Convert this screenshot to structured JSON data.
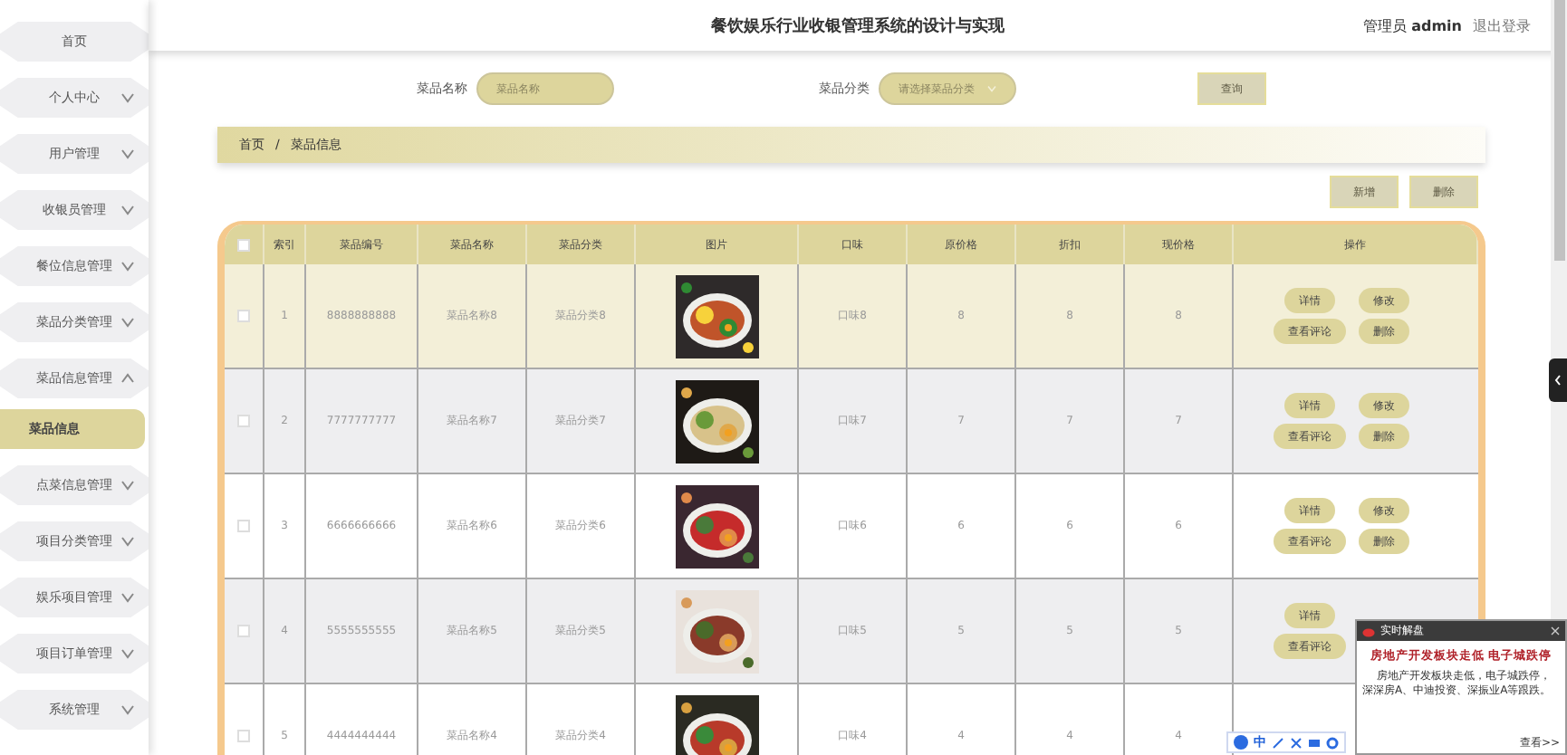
{
  "sidebar": {
    "items": [
      {
        "label": "首页"
      },
      {
        "label": "个人中心",
        "expanded": false
      },
      {
        "label": "用户管理",
        "expanded": false
      },
      {
        "label": "收银员管理",
        "expanded": false
      },
      {
        "label": "餐位信息管理",
        "expanded": false
      },
      {
        "label": "菜品分类管理",
        "expanded": false
      },
      {
        "label": "菜品信息管理",
        "expanded": true,
        "children": [
          {
            "label": "菜品信息",
            "selected": true
          }
        ]
      },
      {
        "label": "点菜信息管理",
        "expanded": false
      },
      {
        "label": "项目分类管理",
        "expanded": false
      },
      {
        "label": "娱乐项目管理",
        "expanded": false
      },
      {
        "label": "项目订单管理",
        "expanded": false
      },
      {
        "label": "系统管理",
        "expanded": false
      }
    ]
  },
  "header": {
    "title": "餐饮娱乐行业收银管理系统的设计与实现",
    "role": "管理员",
    "user": "admin",
    "logout": "退出登录"
  },
  "search": {
    "fields": [
      {
        "label": "菜品名称",
        "placeholder": "菜品名称",
        "kind": "text"
      },
      {
        "label": "菜品分类",
        "placeholder": "请选择菜品分类",
        "kind": "select"
      }
    ],
    "button": "查询"
  },
  "breadcrumb": {
    "items": [
      "首页",
      "菜品信息"
    ],
    "separator": "/"
  },
  "actions": [
    "新增",
    "删除"
  ],
  "table": {
    "header_checked": false,
    "columns": [
      "索引",
      "菜品编号",
      "菜品名称",
      "菜品分类",
      "图片",
      "口味",
      "原价格",
      "折扣",
      "现价格",
      "操作"
    ],
    "rows": [
      {
        "checked": false,
        "selected": true,
        "index": "1",
        "code": "8888888888",
        "name": "菜品名称8",
        "category": "菜品分类8",
        "taste": "口味8",
        "price": "8",
        "discount": "8",
        "current": "8",
        "buttons": [
          [
            "详情",
            "修改"
          ],
          [
            "查看评论",
            "删除"
          ]
        ],
        "picture": {
          "kind": "picture"
        }
      },
      {
        "checked": false,
        "selected": false,
        "index": "2",
        "code": "7777777777",
        "name": "菜品名称7",
        "category": "菜品分类7",
        "taste": "口味7",
        "price": "7",
        "discount": "7",
        "current": "7",
        "buttons": [
          [
            "详情",
            "修改"
          ],
          [
            "查看评论",
            "删除"
          ]
        ],
        "picture": {
          "kind": "picture"
        }
      },
      {
        "checked": false,
        "selected": false,
        "index": "3",
        "code": "6666666666",
        "name": "菜品名称6",
        "category": "菜品分类6",
        "taste": "口味6",
        "price": "6",
        "discount": "6",
        "current": "6",
        "buttons": [
          [
            "详情",
            "修改"
          ],
          [
            "查看评论",
            "删除"
          ]
        ],
        "picture": {
          "kind": "picture"
        }
      },
      {
        "checked": false,
        "selected": false,
        "index": "4",
        "code": "5555555555",
        "name": "菜品名称5",
        "category": "菜品分类5",
        "taste": "口味5",
        "price": "5",
        "discount": "5",
        "current": "5",
        "buttons": [
          [
            "详情"
          ],
          [
            "查看评论"
          ]
        ],
        "picture": {
          "kind": "picture"
        }
      },
      {
        "checked": false,
        "selected": false,
        "index": "5",
        "code": "4444444444",
        "name": "菜品名称4",
        "category": "菜品分类4",
        "taste": "口味4",
        "price": "4",
        "discount": "4",
        "current": "4",
        "picture": {
          "kind": "picture"
        }
      }
    ]
  },
  "popup": {
    "title": "实时解盘",
    "headline": "房地产开发板块走低  电子城跌停",
    "body": "房地产开发板块走低，电子城跌停，深深房A、中迪投资、深振业A等跟跌。",
    "more": "查看>>"
  },
  "ime_bar": {
    "mode": "中"
  }
}
